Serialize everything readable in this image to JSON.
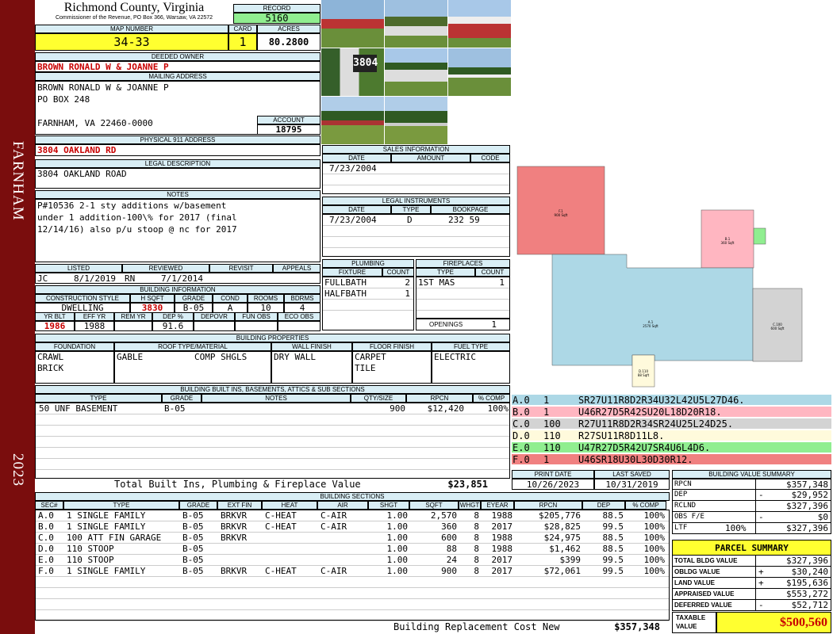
{
  "sidebar": {
    "district": "FARNHAM",
    "year": "2023"
  },
  "header": {
    "county": "Richmond County, Virginia",
    "commissioner": "Commissioner of the Revenue, PO Box 366, Warsaw, VA 22572",
    "record_label": "RECORD",
    "record": "5160",
    "map_label": "MAP NUMBER",
    "map_number": "34-33",
    "card_label": "CARD",
    "card": "1",
    "acres_label": "ACRES",
    "acres": "80.2800"
  },
  "owner": {
    "deeded_label": "DEEDED OWNER",
    "deeded": "BROWN RONALD W & JOANNE P",
    "mailing_label": "MAILING ADDRESS",
    "mailing": [
      "BROWN RONALD W & JOANNE P",
      "PO BOX 248",
      "",
      "FARNHAM, VA 22460-0000"
    ],
    "account_label": "ACCOUNT",
    "account": "18795",
    "physical_label": "PHYSICAL 911 ADDRESS",
    "physical": "3804 OAKLAND RD",
    "legal_label": "LEGAL DESCRIPTION",
    "legal": "3804 OAKLAND ROAD",
    "notes_label": "NOTES",
    "notes": [
      "P#10536 2-1 sty additions w/basement",
      "under 1 addition-100\\% for 2017 (final",
      "12/14/16) also p/u stoop @ nc for 2017"
    ]
  },
  "listing": {
    "listed_label": "LISTED",
    "reviewed_label": "REVIEWED",
    "revisit_label": "REVISIT",
    "appeals_label": "APPEALS",
    "listed_by": "JC",
    "listed_date": "8/1/2019",
    "reviewed_by": "RN",
    "reviewed_date": "7/1/2014"
  },
  "building_info": {
    "title": "BUILDING INFORMATION",
    "headers": [
      "CONSTRUCTION STYLE",
      "H SQFT",
      "GRADE",
      "COND",
      "ROOMS",
      "BDRMS"
    ],
    "values": [
      "DWELLING",
      "3830",
      "B-05",
      "A",
      "10",
      "4"
    ],
    "headers2": [
      "YR BLT",
      "EFF YR",
      "REM YR",
      "DEP %",
      "DEPOVR",
      "FUN OBS",
      "ECO OBS"
    ],
    "values2": [
      "1986",
      "1988",
      "",
      "91.6",
      "",
      "",
      ""
    ]
  },
  "sales": {
    "title": "SALES INFORMATION",
    "headers": [
      "DATE",
      "AMOUNT",
      "CODE"
    ],
    "rows": [
      [
        "7/23/2004",
        "",
        ""
      ]
    ]
  },
  "instruments": {
    "title": "LEGAL INSTRUMENTS",
    "headers": [
      "DATE",
      "TYPE",
      "BOOKPAGE"
    ],
    "rows": [
      [
        "7/23/2004",
        "D",
        "232 59"
      ]
    ]
  },
  "plumbing": {
    "title": "PLUMBING",
    "headers": [
      "FIXTURE",
      "COUNT"
    ],
    "rows": [
      [
        "FULLBATH",
        "2"
      ],
      [
        "HALFBATH",
        "1"
      ]
    ]
  },
  "fireplaces": {
    "title": "FIREPLACES",
    "headers": [
      "TYPE",
      "COUNT"
    ],
    "rows": [
      [
        "1ST MAS",
        "1"
      ]
    ],
    "openings_label": "OPENINGS",
    "openings": "1"
  },
  "properties": {
    "title": "BUILDING PROPERTIES",
    "headers": [
      "FOUNDATION",
      "ROOF TYPE/MATERIAL",
      "WALL FINISH",
      "FLOOR FINISH",
      "FUEL TYPE"
    ],
    "foundation": [
      "CRAWL",
      "BRICK"
    ],
    "roof_type": "GABLE",
    "roof_mat": "COMP SHGLS",
    "wall": "DRY WALL",
    "floor": [
      "CARPET",
      "TILE"
    ],
    "fuel": "ELECTRIC"
  },
  "builtins": {
    "title": "BUILDING BUILT INS, BASEMENTS, ATTICS & SUB SECTIONS",
    "headers": [
      "TYPE",
      "GRADE",
      "NOTES",
      "QTY/SIZE",
      "RPCN",
      "% COMP"
    ],
    "rows": [
      [
        "50 UNF BASEMENT",
        "B-05",
        "",
        "900",
        "$12,420",
        "100%"
      ]
    ],
    "total_label": "Total Built Ins, Plumbing & Fireplace Value",
    "total": "$23,851"
  },
  "sketch_codes": [
    {
      "id": "A.0",
      "n": "1",
      "code": "SR27U11R8D2R34U32L42U5L27D46.",
      "color": "#add8e6"
    },
    {
      "id": "B.0",
      "n": "1",
      "code": "U46R27D5R42SU20L18D20R18.",
      "color": "#ffb6c1"
    },
    {
      "id": "C.0",
      "n": "100",
      "code": "R27U11R8D2R34SR24U25L24D25.",
      "color": "#d3d3d3"
    },
    {
      "id": "D.0",
      "n": "110",
      "code": "R27SU11R8D11L8.",
      "color": "#fffadc"
    },
    {
      "id": "E.0",
      "n": "110",
      "code": "U47R27D5R42U7SR4U6L4D6.",
      "color": "#90ee90"
    },
    {
      "id": "F.0",
      "n": "1",
      "code": "U46SR18U30L30D30R12.",
      "color": "#f08080"
    }
  ],
  "dates": {
    "print_label": "PRINT DATE",
    "print": "10/26/2023",
    "saved_label": "LAST SAVED",
    "saved": "10/31/2019"
  },
  "sections": {
    "title": "BUILDING SECTIONS",
    "headers": [
      "SEC#",
      "TYPE",
      "GRADE",
      "EXT FIN",
      "HEAT",
      "AIR",
      "SHGT",
      "SQFT",
      "WHGT",
      "EYEAR",
      "RPCN",
      "DEP",
      "% COMP"
    ],
    "rows": [
      [
        "A.0",
        "1 SINGLE FAMILY",
        "B-05",
        "BRKVR",
        "C-HEAT",
        "C-AIR",
        "1.00",
        "2,570",
        "8",
        "1988",
        "$205,776",
        "88.5",
        "100%"
      ],
      [
        "B.0",
        "1 SINGLE FAMILY",
        "B-05",
        "BRKVR",
        "C-HEAT",
        "C-AIR",
        "1.00",
        "360",
        "8",
        "2017",
        "$28,825",
        "99.5",
        "100%"
      ],
      [
        "C.0",
        "100 ATT FIN GARAGE",
        "B-05",
        "BRKVR",
        "",
        "",
        "1.00",
        "600",
        "8",
        "1988",
        "$24,975",
        "88.5",
        "100%"
      ],
      [
        "D.0",
        "110 STOOP",
        "B-05",
        "",
        "",
        "",
        "1.00",
        "88",
        "8",
        "1988",
        "$1,462",
        "88.5",
        "100%"
      ],
      [
        "E.0",
        "110 STOOP",
        "B-05",
        "",
        "",
        "",
        "1.00",
        "24",
        "8",
        "2017",
        "$399",
        "99.5",
        "100%"
      ],
      [
        "F.0",
        "1 SINGLE FAMILY",
        "B-05",
        "BRKVR",
        "C-HEAT",
        "C-AIR",
        "1.00",
        "900",
        "8",
        "2017",
        "$72,061",
        "99.5",
        "100%"
      ]
    ],
    "total_label": "Building Replacement Cost New",
    "total": "$357,348"
  },
  "value_summary": {
    "title": "BUILDING VALUE SUMMARY",
    "rows": [
      {
        "label": "RPCN",
        "sign": "",
        "value": "$357,348"
      },
      {
        "label": "DEP",
        "sign": "-",
        "value": "$29,952"
      },
      {
        "label": "RCLND",
        "sign": "",
        "value": "$327,396"
      },
      {
        "label": "OBS F/E",
        "sign": "-",
        "value": "$0"
      },
      {
        "label": "LTF",
        "pct": "100%",
        "sign": "",
        "value": "$327,396"
      }
    ]
  },
  "parcel": {
    "title": "PARCEL SUMMARY",
    "rows": [
      {
        "label": "TOTAL BLDG VALUE",
        "sign": "",
        "value": "$327,396"
      },
      {
        "label": "OBLDG VALUE",
        "sign": "+",
        "value": "$30,240"
      },
      {
        "label": "LAND VALUE",
        "sign": "+",
        "value": "$195,636"
      },
      {
        "label": "APPRAISED VALUE",
        "sign": "",
        "value": "$553,272"
      },
      {
        "label": "DEFERRED VALUE",
        "sign": "-",
        "value": "$52,712"
      }
    ],
    "taxable_label": "TAXABLE VALUE",
    "taxable": "$500,560"
  },
  "sketch": {
    "labels": {
      "F": "F.1\n900 Sqft",
      "B": "B.1\n360 Sqft",
      "A": "A.1\n2570 Sqft",
      "C": "C.100\n600 Sqft",
      "D": "D.110\n88 Sqft"
    }
  }
}
